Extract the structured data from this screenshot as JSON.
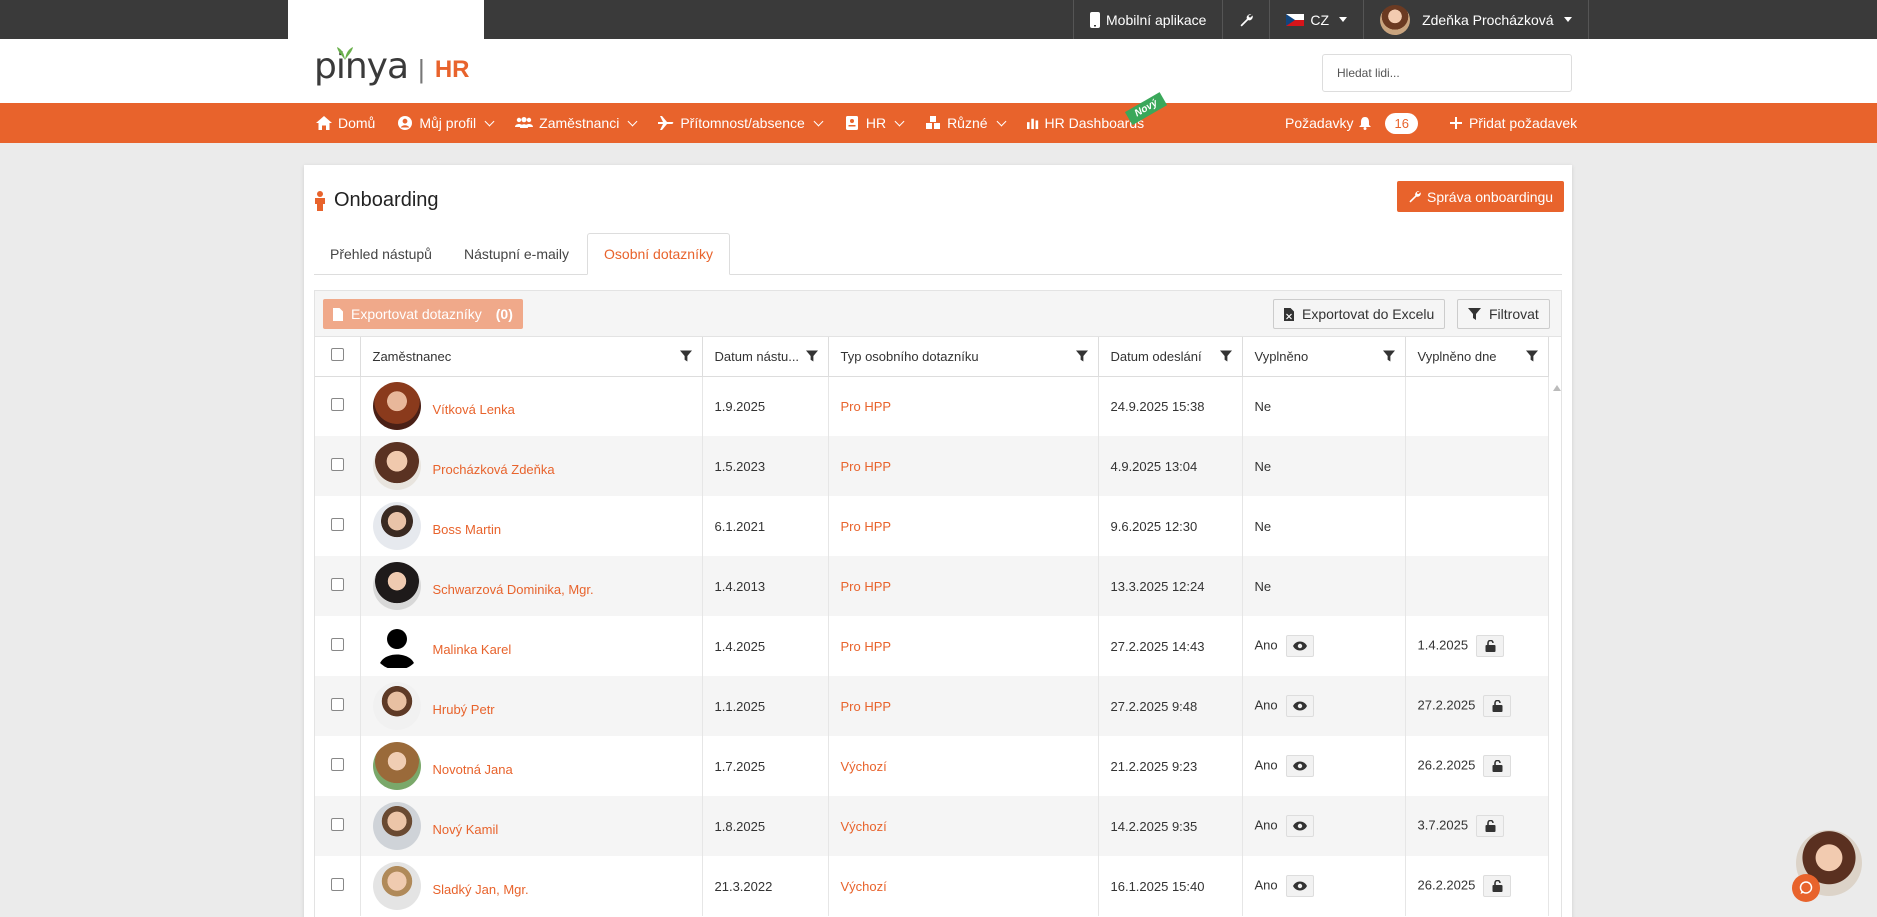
{
  "topbar": {
    "mobile_app": "Mobilní aplikace",
    "language": "CZ",
    "user_name": "Zdeňka Procházková"
  },
  "header": {
    "logo_word": "pinya",
    "logo_sep": "|",
    "logo_suffix": "HR",
    "search_placeholder": "Hledat lidi..."
  },
  "nav": {
    "items": [
      {
        "label": "Domů",
        "icon": "home-icon"
      },
      {
        "label": "Můj profil",
        "icon": "user-circle-icon"
      },
      {
        "label": "Zaměstnanci",
        "icon": "users-icon"
      },
      {
        "label": "Přítomnost/absence",
        "icon": "plane-icon"
      },
      {
        "label": "HR",
        "icon": "id-card-icon"
      },
      {
        "label": "Různé",
        "icon": "cubes-icon"
      },
      {
        "label": "HR Dashboards",
        "icon": "bar-chart-icon"
      }
    ],
    "new_badge": "Nový",
    "requests_label": "Požadavky",
    "requests_count": "16",
    "add_request": "Přidat požadavek"
  },
  "page": {
    "title": "Onboarding",
    "manage_button": "Správa onboardingu",
    "tabs": [
      "Přehled nástupů",
      "Nástupní e-maily",
      "Osobní dotazníky"
    ],
    "active_tab": 2
  },
  "toolbar": {
    "export_label": "Exportovat dotazníky",
    "export_count": "(0)",
    "excel_label": "Exportovat do Excelu",
    "filter_label": "Filtrovat"
  },
  "columns": [
    "Zaměstnanec",
    "Datum nástu...",
    "Typ osobního dotazníku",
    "Datum odeslání",
    "Vyplněno",
    "Vyplněno dne"
  ],
  "rows": [
    {
      "name": "Vítková Lenka",
      "start": "1.9.2025",
      "type": "Pro HPP",
      "sent": "24.9.2025 15:38",
      "filled": "Ne",
      "filled_on": ""
    },
    {
      "name": "Procházková Zdeňka",
      "start": "1.5.2023",
      "type": "Pro HPP",
      "sent": "4.9.2025 13:04",
      "filled": "Ne",
      "filled_on": ""
    },
    {
      "name": "Boss Martin",
      "start": "6.1.2021",
      "type": "Pro HPP",
      "sent": "9.6.2025 12:30",
      "filled": "Ne",
      "filled_on": ""
    },
    {
      "name": "Schwarzová Dominika, Mgr.",
      "start": "1.4.2013",
      "type": "Pro HPP",
      "sent": "13.3.2025 12:24",
      "filled": "Ne",
      "filled_on": ""
    },
    {
      "name": "Malinka Karel",
      "start": "1.4.2025",
      "type": "Pro HPP",
      "sent": "27.2.2025 14:43",
      "filled": "Ano",
      "filled_on": "1.4.2025"
    },
    {
      "name": "Hrubý Petr",
      "start": "1.1.2025",
      "type": "Pro HPP",
      "sent": "27.2.2025 9:48",
      "filled": "Ano",
      "filled_on": "27.2.2025"
    },
    {
      "name": "Novotná Jana",
      "start": "1.7.2025",
      "type": "Výchozí",
      "sent": "21.2.2025 9:23",
      "filled": "Ano",
      "filled_on": "26.2.2025"
    },
    {
      "name": "Nový Kamil",
      "start": "1.8.2025",
      "type": "Výchozí",
      "sent": "14.2.2025 9:35",
      "filled": "Ano",
      "filled_on": "3.7.2025"
    },
    {
      "name": "Sladký Jan, Mgr.",
      "start": "21.3.2022",
      "type": "Výchozí",
      "sent": "16.1.2025 15:40",
      "filled": "Ano",
      "filled_on": "26.2.2025"
    }
  ],
  "colors": {
    "accent": "#e8632c",
    "topbar": "#3a3a3a",
    "new_badge": "#3aa85a"
  }
}
